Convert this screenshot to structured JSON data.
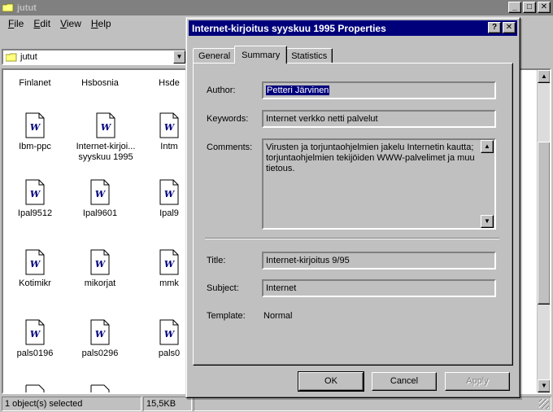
{
  "explorer": {
    "title": "jutut",
    "menu": [
      {
        "label": "File",
        "key": "F",
        "rest": "ile"
      },
      {
        "label": "Edit",
        "key": "E",
        "rest": "dit"
      },
      {
        "label": "View",
        "key": "V",
        "rest": "iew"
      },
      {
        "label": "Help",
        "key": "H",
        "rest": "elp"
      }
    ],
    "address_value": "jutut",
    "icons": [
      {
        "label": "Finlanet"
      },
      {
        "label": "Hsbosnia"
      },
      {
        "label": "Hsde"
      },
      {
        "label": "Ibm-ppc"
      },
      {
        "label": "Internet-kirjoi... syyskuu 1995"
      },
      {
        "label": "Intm"
      },
      {
        "label": "Ipal9512"
      },
      {
        "label": "Ipal9601"
      },
      {
        "label": "Ipal9"
      },
      {
        "label": "Kotimikr"
      },
      {
        "label": "mikorjat"
      },
      {
        "label": "mmk"
      },
      {
        "label": "pals0196"
      },
      {
        "label": "pals0296"
      },
      {
        "label": "pals0"
      }
    ],
    "status": {
      "selection": "1 object(s) selected",
      "size": "15,5KB"
    }
  },
  "dialog": {
    "title": "Internet-kirjoitus syyskuu 1995 Properties",
    "help_glyph": "?",
    "close_glyph": "✕",
    "tabs": [
      {
        "label": "General",
        "active": false
      },
      {
        "label": "Summary",
        "active": true
      },
      {
        "label": "Statistics",
        "active": false
      }
    ],
    "fields": {
      "author_label": "Author:",
      "author_value": "Petteri Järvinen",
      "keywords_label": "Keywords:",
      "keywords_value": "Internet verkko netti palvelut",
      "comments_label": "Comments:",
      "comments_value": "Virusten ja torjuntaohjelmien jakelu Internetin kautta; torjuntaohjelmien tekijöiden WWW-palvelimet ja muu tietous.",
      "title_label": "Title:",
      "title_value": "Internet-kirjoitus 9/95",
      "subject_label": "Subject:",
      "subject_value": "Internet",
      "template_label": "Template:",
      "template_value": "Normal"
    },
    "buttons": {
      "ok": "OK",
      "cancel": "Cancel",
      "apply": "Apply"
    }
  },
  "colors": {
    "face": "#c0c0c0",
    "title_active": "#00007b",
    "title_inactive": "#808080",
    "selection": "#00007b"
  },
  "icon_names": {
    "folder": "folder-icon",
    "word_doc": "word-document-icon"
  }
}
